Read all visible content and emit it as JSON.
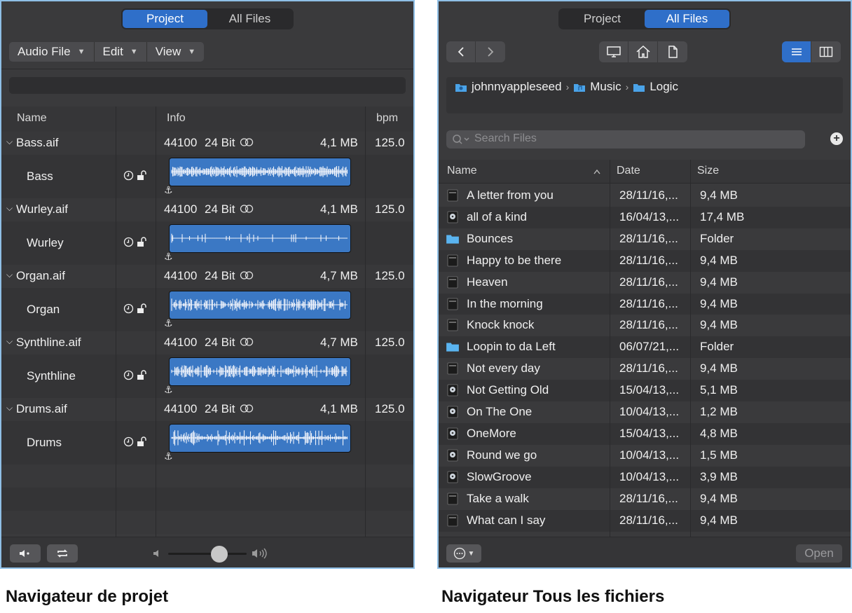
{
  "project_browser": {
    "tabs": [
      "Project",
      "All Files"
    ],
    "active_tab": "Project",
    "menus": [
      "Audio File",
      "Edit",
      "View"
    ],
    "columns": {
      "name": "Name",
      "info": "Info",
      "bpm": "bpm"
    },
    "files": [
      {
        "file": "Bass.aif",
        "rate": "44100",
        "bits": "24 Bit",
        "size": "4,1 MB",
        "bpm": "125.0",
        "region": "Bass",
        "waveform": "dense"
      },
      {
        "file": "Wurley.aif",
        "rate": "44100",
        "bits": "24 Bit",
        "size": "4,1 MB",
        "bpm": "125.0",
        "region": "Wurley",
        "waveform": "sparse"
      },
      {
        "file": "Organ.aif",
        "rate": "44100",
        "bits": "24 Bit",
        "size": "4,7 MB",
        "bpm": "125.0",
        "region": "Organ",
        "waveform": "medium"
      },
      {
        "file": "Synthline.aif",
        "rate": "44100",
        "bits": "24 Bit",
        "size": "4,7 MB",
        "bpm": "125.0",
        "region": "Synthline",
        "waveform": "medium"
      },
      {
        "file": "Drums.aif",
        "rate": "44100",
        "bits": "24 Bit",
        "size": "4,1 MB",
        "bpm": "125.0",
        "region": "Drums",
        "waveform": "spiky"
      }
    ],
    "volume_level": 0.65,
    "caption": "Navigateur de projet"
  },
  "all_files_browser": {
    "tabs": [
      "Project",
      "All Files"
    ],
    "active_tab": "All Files",
    "path": [
      "johnnyappleseed",
      "Music",
      "Logic"
    ],
    "search_placeholder": "Search Files",
    "columns": {
      "name": "Name",
      "date": "Date",
      "size": "Size"
    },
    "sort": "name-ascending",
    "files": [
      {
        "name": "A letter from you",
        "date": "28/11/16,...",
        "size": "9,4 MB",
        "kind": "file"
      },
      {
        "name": "all of a kind",
        "date": "16/04/13,...",
        "size": "17,4 MB",
        "kind": "project"
      },
      {
        "name": "Bounces",
        "date": "28/11/16,...",
        "size": "Folder",
        "kind": "folder"
      },
      {
        "name": "Happy to be there",
        "date": "28/11/16,...",
        "size": "9,4 MB",
        "kind": "file"
      },
      {
        "name": "Heaven",
        "date": "28/11/16,...",
        "size": "9,4 MB",
        "kind": "file"
      },
      {
        "name": "In the morning",
        "date": "28/11/16,...",
        "size": "9,4 MB",
        "kind": "file"
      },
      {
        "name": "Knock knock",
        "date": "28/11/16,...",
        "size": "9,4 MB",
        "kind": "file"
      },
      {
        "name": "Loopin to da Left",
        "date": "06/07/21,...",
        "size": "Folder",
        "kind": "folder"
      },
      {
        "name": "Not every day",
        "date": "28/11/16,...",
        "size": "9,4 MB",
        "kind": "file"
      },
      {
        "name": "Not Getting Old",
        "date": "15/04/13,...",
        "size": "5,1 MB",
        "kind": "project"
      },
      {
        "name": "On The One",
        "date": "10/04/13,...",
        "size": "1,2 MB",
        "kind": "project"
      },
      {
        "name": "OneMore",
        "date": "15/04/13,...",
        "size": "4,8 MB",
        "kind": "project"
      },
      {
        "name": "Round we go",
        "date": "10/04/13,...",
        "size": "1,5 MB",
        "kind": "project"
      },
      {
        "name": "SlowGroove",
        "date": "10/04/13,...",
        "size": "3,9 MB",
        "kind": "project"
      },
      {
        "name": "Take a walk",
        "date": "28/11/16,...",
        "size": "9,4 MB",
        "kind": "file"
      },
      {
        "name": "What can I say",
        "date": "28/11/16,...",
        "size": "9,4 MB",
        "kind": "file"
      }
    ],
    "open_label": "Open",
    "caption": "Navigateur Tous les fichiers"
  },
  "colors": {
    "accent": "#2f6fc9",
    "waveform_fill": "#3b78c4",
    "folder": "#5ab4f0"
  }
}
